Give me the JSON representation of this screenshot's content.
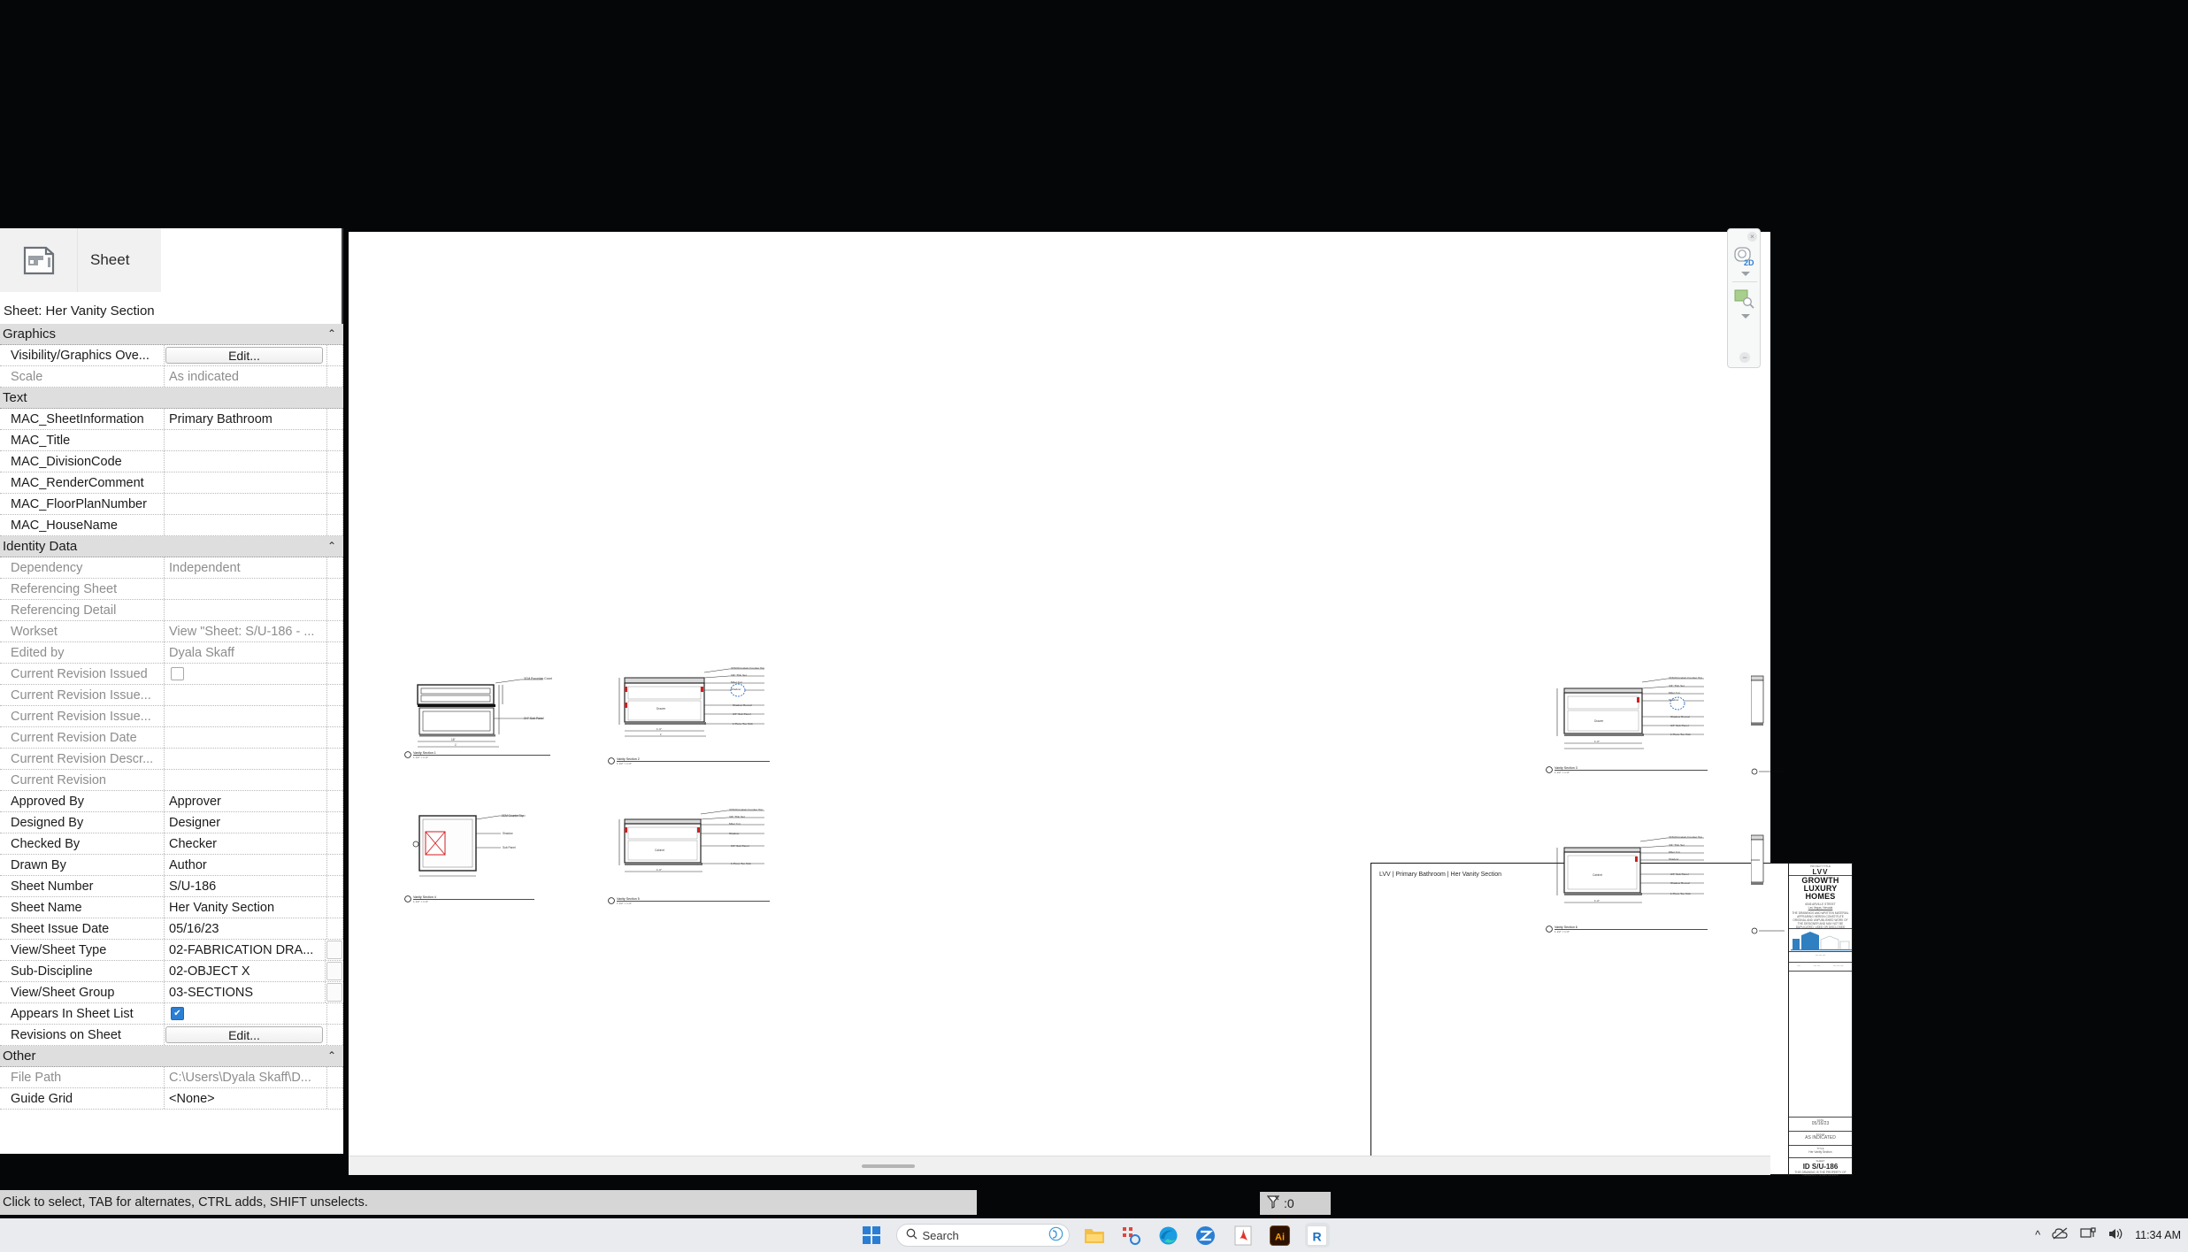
{
  "app": {
    "name": "Autodesk Revit",
    "status_bar_text": "Click to select, TAB for alternates, CTRL adds, SHIFT unselects.",
    "selection_count": ":0",
    "selection_icon": "filter-icon"
  },
  "properties_palette": {
    "type_selector": {
      "icon": "sheet-icon",
      "label": "Sheet"
    },
    "type_name": "Sheet: Her Vanity Section",
    "groups": [
      {
        "name": "Graphics",
        "collapsible": true,
        "rows": [
          {
            "name": "Visibility/Graphics Ove...",
            "value": "Edit...",
            "kind": "button",
            "readonly": false
          },
          {
            "name": "Scale",
            "value": "As indicated",
            "kind": "text",
            "readonly": true
          }
        ]
      },
      {
        "name": "Text",
        "collapsible": false,
        "rows": [
          {
            "name": "MAC_SheetInformation",
            "value": "Primary Bathroom",
            "kind": "text",
            "readonly": false
          },
          {
            "name": "MAC_Title",
            "value": "",
            "kind": "text",
            "readonly": false
          },
          {
            "name": "MAC_DivisionCode",
            "value": "",
            "kind": "text",
            "readonly": false
          },
          {
            "name": "MAC_RenderComment",
            "value": "",
            "kind": "text",
            "readonly": false
          },
          {
            "name": "MAC_FloorPlanNumber",
            "value": "",
            "kind": "text",
            "readonly": false
          },
          {
            "name": "MAC_HouseName",
            "value": "",
            "kind": "text",
            "readonly": false
          }
        ]
      },
      {
        "name": "Identity Data",
        "collapsible": true,
        "rows": [
          {
            "name": "Dependency",
            "value": "Independent",
            "kind": "text",
            "readonly": true
          },
          {
            "name": "Referencing Sheet",
            "value": "",
            "kind": "text",
            "readonly": true
          },
          {
            "name": "Referencing Detail",
            "value": "",
            "kind": "text",
            "readonly": true
          },
          {
            "name": "Workset",
            "value": "View \"Sheet: S/U-186 - ...",
            "kind": "text",
            "readonly": true
          },
          {
            "name": "Edited by",
            "value": "Dyala Skaff",
            "kind": "text",
            "readonly": true
          },
          {
            "name": "Current Revision Issued",
            "value": "",
            "kind": "checkbox",
            "checked": false,
            "readonly": true
          },
          {
            "name": "Current Revision Issue...",
            "value": "",
            "kind": "text",
            "readonly": true
          },
          {
            "name": "Current Revision Issue...",
            "value": "",
            "kind": "text",
            "readonly": true
          },
          {
            "name": "Current Revision Date",
            "value": "",
            "kind": "text",
            "readonly": true
          },
          {
            "name": "Current Revision Descr...",
            "value": "",
            "kind": "text",
            "readonly": true
          },
          {
            "name": "Current Revision",
            "value": "",
            "kind": "text",
            "readonly": true
          },
          {
            "name": "Approved By",
            "value": "Approver",
            "kind": "text",
            "readonly": false
          },
          {
            "name": "Designed By",
            "value": "Designer",
            "kind": "text",
            "readonly": false
          },
          {
            "name": "Checked By",
            "value": "Checker",
            "kind": "text",
            "readonly": false
          },
          {
            "name": "Drawn By",
            "value": "Author",
            "kind": "text",
            "readonly": false
          },
          {
            "name": "Sheet Number",
            "value": "S/U-186",
            "kind": "text",
            "readonly": false
          },
          {
            "name": "Sheet Name",
            "value": "Her Vanity Section",
            "kind": "text",
            "readonly": false
          },
          {
            "name": "Sheet Issue Date",
            "value": "05/16/23",
            "kind": "text",
            "readonly": false
          },
          {
            "name": "View/Sheet Type",
            "value": "02-FABRICATION DRA...",
            "kind": "dropdown",
            "readonly": false
          },
          {
            "name": "Sub-Discipline",
            "value": "02-OBJECT X",
            "kind": "dropdown",
            "readonly": false
          },
          {
            "name": "View/Sheet Group",
            "value": "03-SECTIONS",
            "kind": "dropdown",
            "readonly": false
          },
          {
            "name": "Appears In Sheet List",
            "value": "",
            "kind": "checkbox",
            "checked": true,
            "readonly": false
          },
          {
            "name": "Revisions on Sheet",
            "value": "Edit...",
            "kind": "button",
            "readonly": false
          }
        ]
      },
      {
        "name": "Other",
        "collapsible": true,
        "rows": [
          {
            "name": "File Path",
            "value": "C:\\Users\\Dyala Skaff\\D...",
            "kind": "text",
            "readonly": true
          },
          {
            "name": "Guide Grid",
            "value": "<None>",
            "kind": "text",
            "readonly": false
          }
        ]
      }
    ]
  },
  "nav_bar": {
    "close_glyph": "×",
    "steering_wheel_label": "2D",
    "icons": [
      "steering-wheel-2d-icon",
      "zoom-region-icon"
    ]
  },
  "sheet": {
    "header": "LVV | Primary Bathroom | Her Vanity Section",
    "title_block": {
      "project_title_caption": "PROJECT TITLE",
      "project_title": "LVV",
      "company": "GROWTH LUXURY HOMES",
      "address": "6545 ARVILLE STREET",
      "city": "Las Vegas, Nevada",
      "legal": "THE DRAWINGS AND WRITTEN MATERIAL APPEARING HEREIN CONSTITUTE ORIGINAL AND UNPUBLISHED WORK OF THE DESIGNER AND MAY NOT BE DUPLICATED, USED OR DISCLOSED WITHOUT THE WRITTEN CONSENT OF THE DESIGNER",
      "date_caption": "DATE",
      "date": "05/16/23",
      "scale_caption": "SCALE",
      "scale": "AS INDICATED",
      "title_caption": "TITLE",
      "title": "Her Vanity Section",
      "sheet_caption": "SHEET",
      "sheet_id": "ID S/U-186",
      "footer": "THIS DRAWING IS THE PROPERTY OF GROWTH LUXURY HOMES"
    },
    "views": [
      {
        "name": "Vanity Section 1",
        "label": "Vanity Section 1",
        "scale": "1 1/2\" = 1'-0\""
      },
      {
        "name": "Vanity Section 2",
        "label": "Vanity Section 2",
        "scale": "1 1/2\" = 1'-0\""
      },
      {
        "name": "Vanity Section 3",
        "label": "Vanity Section 3",
        "scale": "1 1/2\" = 1'-0\""
      },
      {
        "name": "Vanity Section 4",
        "label": "Vanity Section 4",
        "scale": "1 1/2\" = 1'-0\""
      },
      {
        "name": "Vanity Section 5",
        "label": "Vanity Section 5",
        "scale": "1 1/2\" = 1'-0\""
      },
      {
        "name": "Vanity Section 6",
        "label": "Vanity Section 6",
        "scale": "1 1/2\" = 1'-0\""
      }
    ],
    "annotations": [
      "3CM Porcelain Counter Top",
      "3/4\" Thin Set",
      "Miter Cut",
      "Shadow",
      "Shadow Reveal",
      "3/4\" Sub Panel",
      "1 Piece Toe Kick",
      "Drawer",
      "Cabinet"
    ]
  },
  "taskbar": {
    "items": [
      {
        "name": "start-button",
        "icon": "windows-logo-icon",
        "label": ""
      },
      {
        "name": "search-box",
        "icon": "search-icon",
        "label": "Search",
        "trailing_icon": "copilot-icon"
      },
      {
        "name": "file-explorer",
        "icon": "folder-icon",
        "label": ""
      },
      {
        "name": "snipping-tool",
        "icon": "scissors-icon",
        "label": ""
      },
      {
        "name": "edge-browser",
        "icon": "edge-icon",
        "label": ""
      },
      {
        "name": "zoom-app",
        "icon": "zoom-video-icon",
        "label": ""
      },
      {
        "name": "acrobat-reader",
        "icon": "pdf-icon",
        "label": ""
      },
      {
        "name": "illustrator",
        "icon": "illustrator-icon",
        "label": "Ai"
      },
      {
        "name": "revit-app",
        "icon": "revit-icon",
        "label": "R"
      }
    ],
    "tray": {
      "overflow_glyph": "^",
      "onedrive_icon": "cloud-icon",
      "network_icon": "network-icon",
      "volume_icon": "speaker-icon",
      "time": "11:34 AM"
    }
  },
  "colors": {
    "accent_blue": "#2a7fd4",
    "panel_gray": "#dedede",
    "canvas_white": "#ffffff",
    "desktop_black": "#050607",
    "annotation_red": "#e02020"
  }
}
